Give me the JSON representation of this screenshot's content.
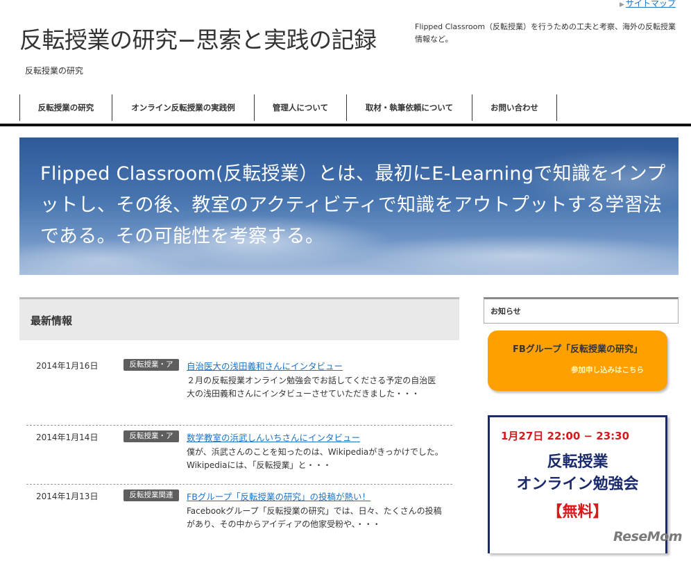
{
  "header": {
    "sitemap_label": "サイトマップ",
    "site_title": "反転授業の研究−思索と実践の記録",
    "site_description": "Flipped Classroom（反転授業）を行うための工夫と考察、海外の反転授業情報など。",
    "breadcrumb": "反転授業の研究"
  },
  "nav": {
    "items": [
      {
        "label": "反転授業の研究"
      },
      {
        "label": "オンライン反転授業の実践例"
      },
      {
        "label": "管理人について"
      },
      {
        "label": "取材・執筆依頼について"
      },
      {
        "label": "お問い合わせ"
      }
    ]
  },
  "hero": {
    "text": "Flipped Classroom(反転授業）とは、最初にE-Learningで知識をインプットし、その後、教室のアクティビティで知識をアウトプットする学習法である。その可能性を考察する。"
  },
  "news": {
    "heading": "最新情報",
    "items": [
      {
        "date": "2014年1月16日",
        "tag": "反転授業・ア",
        "title": "自治医大の浅田義和さんにインタビュー",
        "excerpt": "２月の反転授業オンライン勉強会でお話してくださる予定の自治医大の浅田義和さんにインタビューさせていただきました・・・"
      },
      {
        "date": "2014年1月14日",
        "tag": "反転授業・ア",
        "title": "数学教室の浜武しんいちさんにインタビュー",
        "excerpt": "僕が、浜武さんのことを知ったのは、Wikipediaがきっかけでした。 Wikipediaには、「反転授業」と・・・"
      },
      {
        "date": "2014年1月13日",
        "tag": "反転授業関連",
        "title": "FBグループ「反転授業の研究」の投稿が熱い！",
        "excerpt": "Facebookグループ「反転授業の研究」では、日々、たくさんの投稿があり、その中からアイディアの他家受粉や、・・・"
      }
    ]
  },
  "sidebar": {
    "notice_heading": "お知らせ",
    "fb_banner": {
      "title": "FBグループ「反転授業の研究」",
      "subtitle": "参加申し込みはこちら"
    },
    "event_banner": {
      "datetime": "1月27日 22:00 − 23:30",
      "line1": "反転授業",
      "line2": "オンライン勉強会",
      "price": "【無料】"
    }
  },
  "watermark": "ReseMom"
}
